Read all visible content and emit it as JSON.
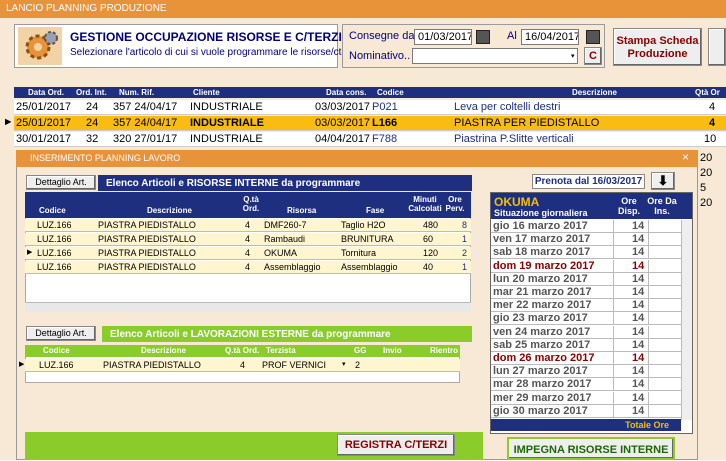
{
  "window": {
    "title": "LANCIO PLANNING PRODUZIONE"
  },
  "header": {
    "title": "GESTIONE OCCUPAZIONE RISORSE E C/TERZI",
    "subtitle": "Selezionare l'articolo di cui si vuole programmare le risorse/cterzi",
    "consegne_label": "Consegne da",
    "date_from": "01/03/2017",
    "al_label": "Al",
    "date_to": "16/04/2017",
    "nominativo_label": "Nominativo..",
    "nominativo_value": "",
    "c_button": "C",
    "print_button": "Stampa Scheda Produzione"
  },
  "main_table": {
    "headers": [
      "Data Ord.",
      "Ord. Int.",
      "Num. Rif.",
      "Cliente",
      "Data cons.",
      "Codice",
      "Descrizione",
      "Qtà Or"
    ],
    "rows": [
      {
        "data": "25/01/2017",
        "ord": "24",
        "rif": "357 24/04/17",
        "cliente": "INDUSTRIALE",
        "cons": "03/03/2017",
        "codice": "P021",
        "desc": "Leva per coltelli destri",
        "qta": "4"
      },
      {
        "data": "25/01/2017",
        "ord": "24",
        "rif": "357 24/04/17",
        "cliente": "INDUSTRIALE",
        "cons": "03/03/2017",
        "codice": "L166",
        "desc": "PIASTRA PER PIEDISTALLO",
        "qta": "4"
      },
      {
        "data": "30/01/2017",
        "ord": "32",
        "rif": "320 27/01/17",
        "cliente": "INDUSTRIALE",
        "cons": "04/04/2017",
        "codice": "F788",
        "desc": "Piastrina P.Slitte verticali",
        "qta": "10"
      }
    ],
    "extra_qta": [
      "20",
      "20",
      "5",
      "20"
    ]
  },
  "dialog": {
    "title": "INSERIMENTO PLANNING LAVORO",
    "close": "×",
    "dettaglio_label": "Dettaglio Art.",
    "internal_title": "Elenco Articoli e RISORSE INTERNE da programmare",
    "internal_headers": [
      "Codice",
      "Descrizione",
      "Q.tà Ord.",
      "Risorsa",
      "Fase",
      "Minuti Calcolati",
      "Ore Perv."
    ],
    "internal_rows": [
      {
        "codice": "LUZ.166",
        "desc": "PIASTRA PIEDISTALLO",
        "qta": "4",
        "risorsa": "DMF260-7",
        "fase": "Taglio H2O",
        "min": "480",
        "ore": "8"
      },
      {
        "codice": "LUZ.166",
        "desc": "PIASTRA PIEDISTALLO",
        "qta": "4",
        "risorsa": "Rambaudi",
        "fase": "BRUNITURA",
        "min": "60",
        "ore": "1"
      },
      {
        "codice": "LUZ.166",
        "desc": "PIASTRA PIEDISTALLO",
        "qta": "4",
        "risorsa": "OKUMA",
        "fase": "Tornitura",
        "min": "120",
        "ore": "2"
      },
      {
        "codice": "LUZ.166",
        "desc": "PIASTRA PIEDISTALLO",
        "qta": "4",
        "risorsa": "Assemblaggio",
        "fase": "Assemblaggio",
        "min": "40",
        "ore": "1"
      }
    ],
    "external_title": "Elenco Articoli e LAVORAZIONI ESTERNE da programmare",
    "external_headers": [
      "Codice",
      "Descrizione",
      "Q.tà Ord.",
      "Terzista",
      "GG",
      "Invio",
      "Rientro"
    ],
    "external_row": {
      "codice": "LUZ.166",
      "desc": "PIASTRA PIEDISTALLO",
      "qta": "4",
      "terzista": "PROF VERNICI",
      "gg": "2",
      "invio": "",
      "rientro": ""
    },
    "registra_button": "REGISTRA C/TERZI",
    "prenota_label": "Prenota dal 16/03/2017",
    "calendar": {
      "resource": "OKUMA",
      "subtitle": "Situazione giornaliera",
      "col_disp": "Ore Disp.",
      "col_ins": "Ore Da Ins.",
      "days": [
        {
          "label": "gio 16 marzo 2017",
          "ore": "14",
          "sunday": false
        },
        {
          "label": "ven 17 marzo 2017",
          "ore": "14",
          "sunday": false
        },
        {
          "label": "sab 18 marzo 2017",
          "ore": "14",
          "sunday": false
        },
        {
          "label": "dom 19 marzo 2017",
          "ore": "14",
          "sunday": true
        },
        {
          "label": "lun 20 marzo 2017",
          "ore": "14",
          "sunday": false
        },
        {
          "label": "mar 21 marzo 2017",
          "ore": "14",
          "sunday": false
        },
        {
          "label": "mer 22 marzo 2017",
          "ore": "14",
          "sunday": false
        },
        {
          "label": "gio 23 marzo 2017",
          "ore": "14",
          "sunday": false
        },
        {
          "label": "ven 24 marzo 2017",
          "ore": "14",
          "sunday": false
        },
        {
          "label": "sab 25 marzo 2017",
          "ore": "14",
          "sunday": false
        },
        {
          "label": "dom 26 marzo 2017",
          "ore": "14",
          "sunday": true
        },
        {
          "label": "lun 27 marzo 2017",
          "ore": "14",
          "sunday": false
        },
        {
          "label": "mar 28 marzo 2017",
          "ore": "14",
          "sunday": false
        },
        {
          "label": "mer 29 marzo 2017",
          "ore": "14",
          "sunday": false
        },
        {
          "label": "gio 30 marzo 2017",
          "ore": "14",
          "sunday": false
        }
      ],
      "totale_label": "Totale Ore"
    },
    "impegna_button": "IMPEGNA RISORSE INTERNE"
  }
}
